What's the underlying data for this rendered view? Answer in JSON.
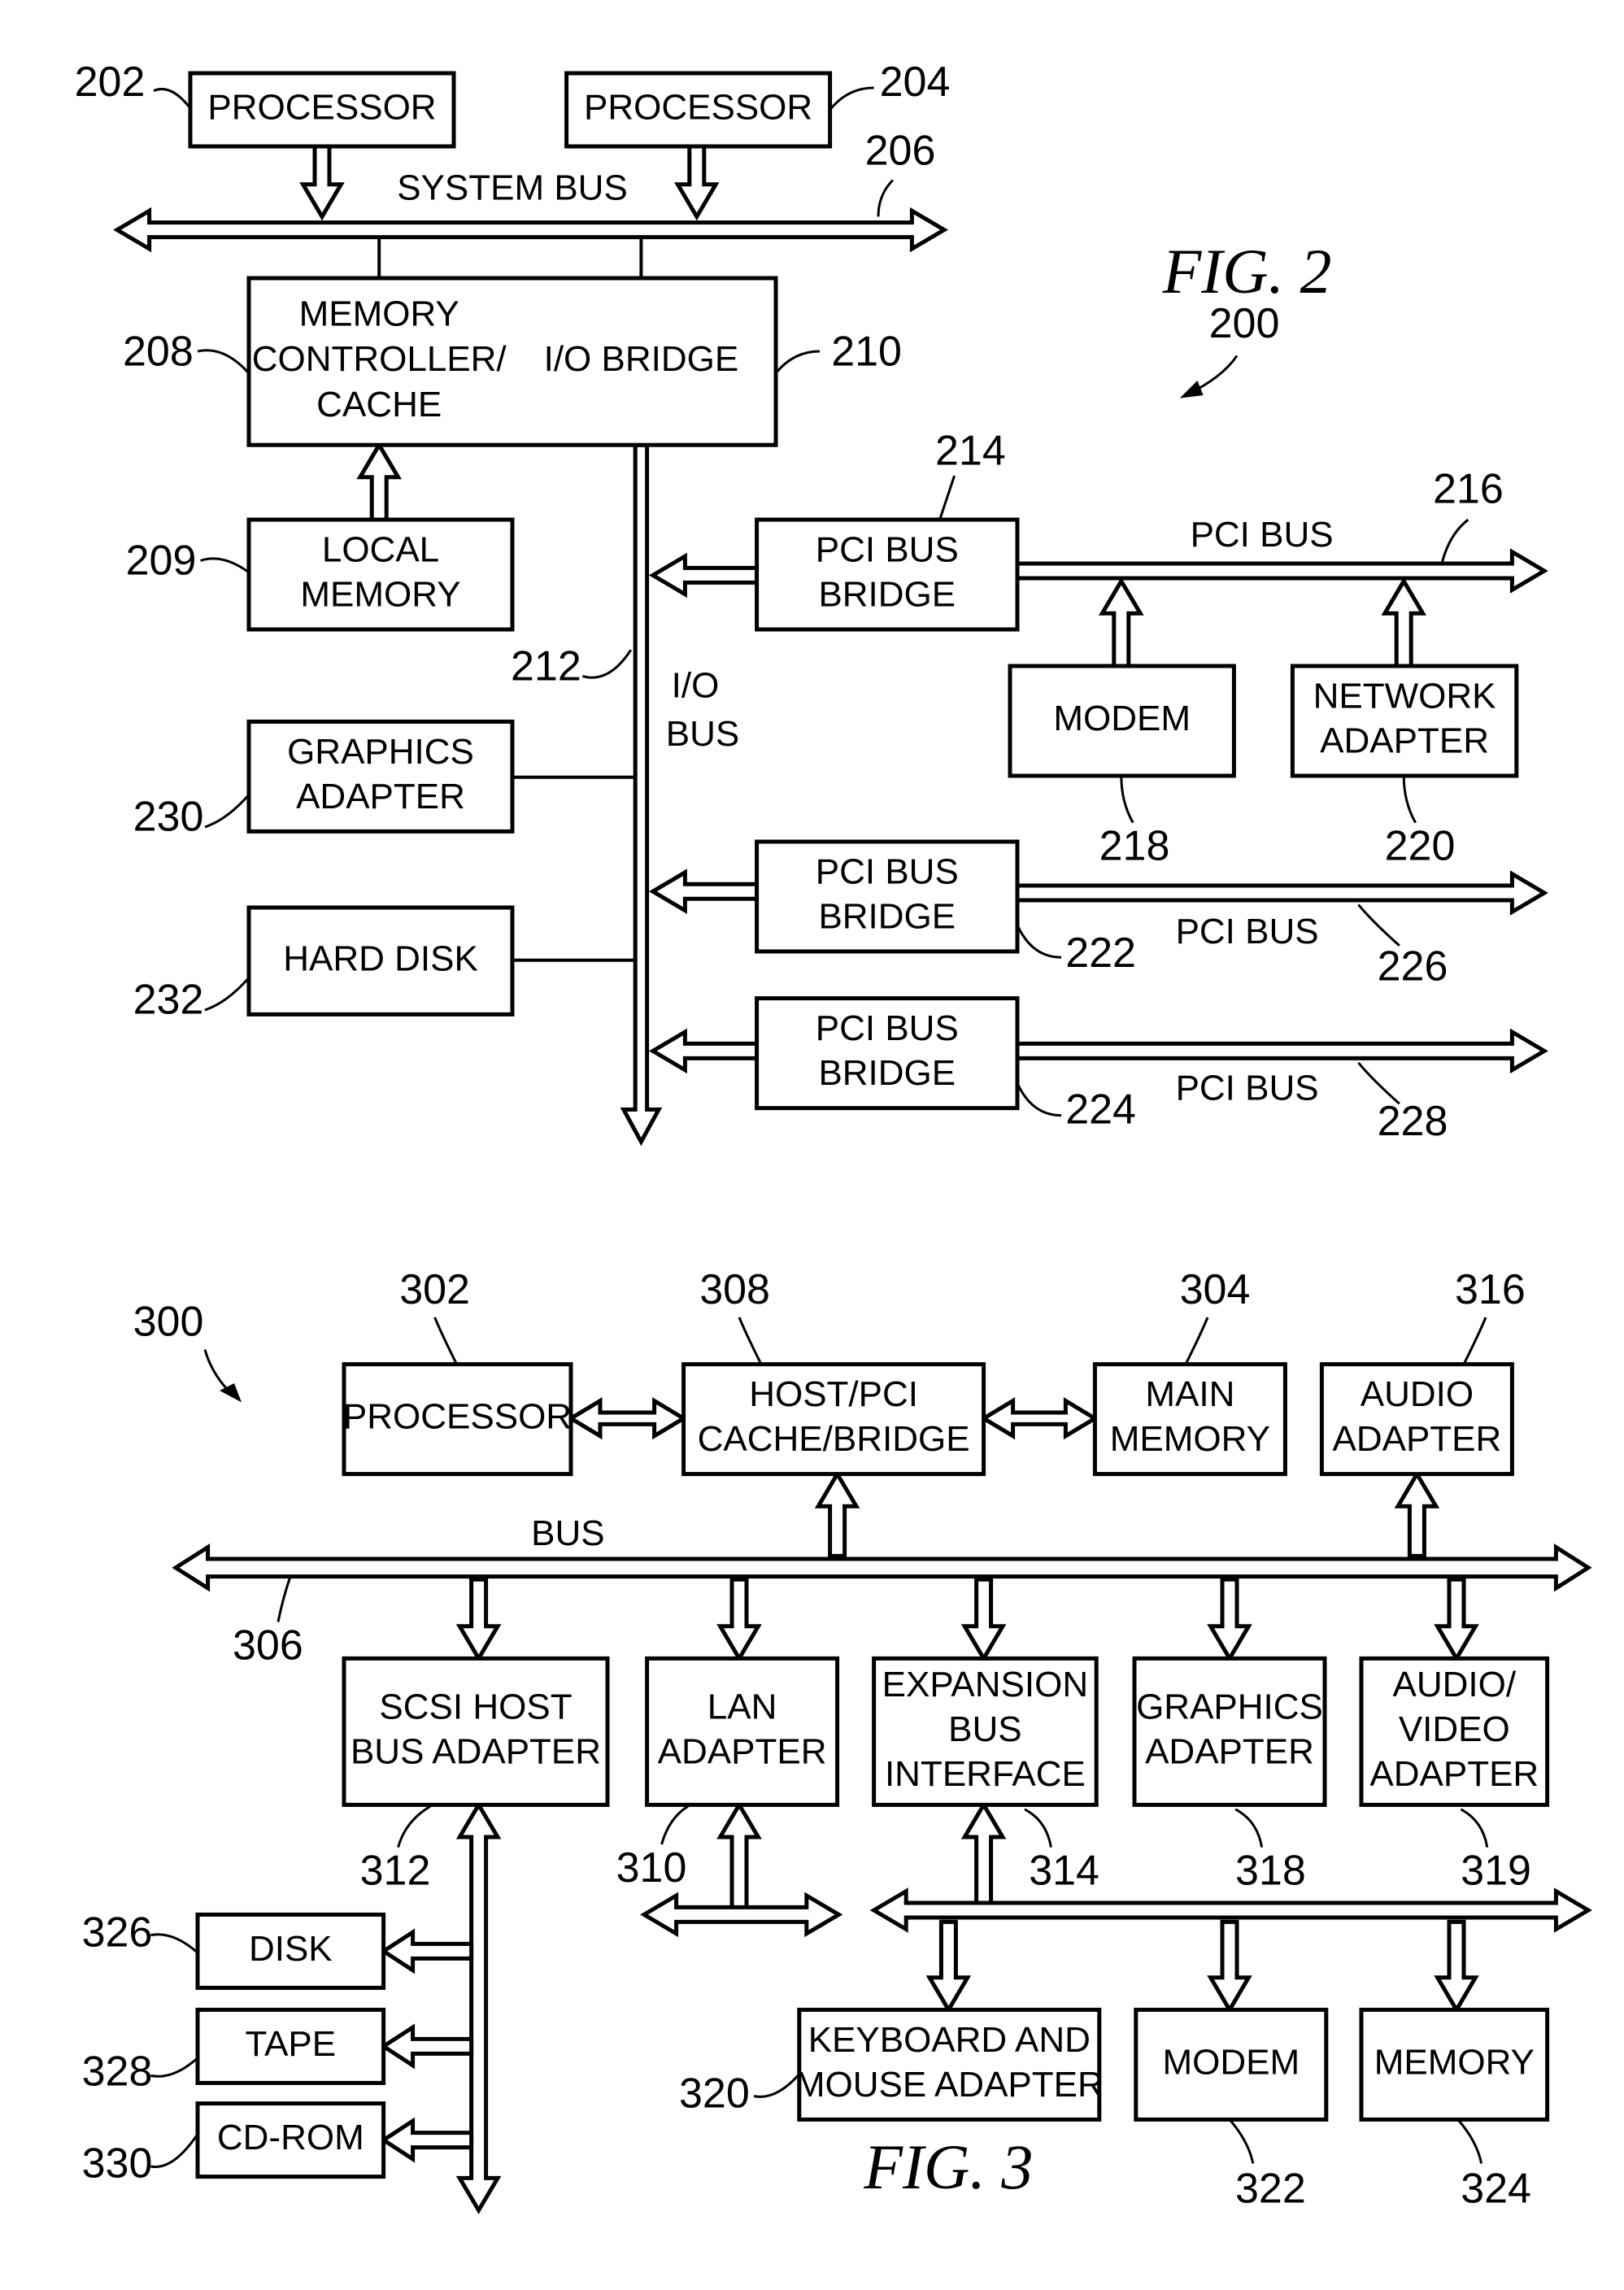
{
  "fig2": {
    "title": "FIG. 2",
    "ref": "200",
    "system_bus_label": "SYSTEM BUS",
    "io_bus_label": [
      "I/O",
      "BUS"
    ],
    "pci_bus_label": "PCI BUS",
    "boxes": {
      "proc1": {
        "lines": [
          "PROCESSOR"
        ],
        "ref": "202"
      },
      "proc2": {
        "lines": [
          "PROCESSOR"
        ],
        "ref": "204"
      },
      "memctrl": {
        "lines": [
          "MEMORY",
          "CONTROLLER/",
          "CACHE"
        ],
        "ref": "208"
      },
      "iobridge": {
        "lines": [
          "I/O BRIDGE"
        ],
        "ref": "210"
      },
      "localmem": {
        "lines": [
          "LOCAL",
          "MEMORY"
        ],
        "ref": "209"
      },
      "graphics": {
        "lines": [
          "GRAPHICS",
          "ADAPTER"
        ],
        "ref": "230"
      },
      "harddisk": {
        "lines": [
          "HARD DISK"
        ],
        "ref": "232"
      },
      "pci1": {
        "lines": [
          "PCI BUS",
          "BRIDGE"
        ],
        "ref": "214"
      },
      "modem": {
        "lines": [
          "MODEM"
        ],
        "ref": "218"
      },
      "netadapter": {
        "lines": [
          "NETWORK",
          "ADAPTER"
        ],
        "ref": "220"
      },
      "pci2": {
        "lines": [
          "PCI BUS",
          "BRIDGE"
        ],
        "ref": "222"
      },
      "pci3": {
        "lines": [
          "PCI BUS",
          "BRIDGE"
        ],
        "ref": "224"
      }
    },
    "refs": {
      "system_bus": "206",
      "io_bus": "212",
      "pci_bus1": "216",
      "pci_bus2": "226",
      "pci_bus3": "228"
    }
  },
  "fig3": {
    "title": "FIG. 3",
    "ref": "300",
    "bus_label": "BUS",
    "boxes": {
      "processor": {
        "lines": [
          "PROCESSOR"
        ],
        "ref": "302"
      },
      "hostpci": {
        "lines": [
          "HOST/PCI",
          "CACHE/BRIDGE"
        ],
        "ref": "308"
      },
      "mainmem": {
        "lines": [
          "MAIN",
          "MEMORY"
        ],
        "ref": "304"
      },
      "audio": {
        "lines": [
          "AUDIO",
          "ADAPTER"
        ],
        "ref": "316"
      },
      "scsi": {
        "lines": [
          "SCSI HOST",
          "BUS ADAPTER"
        ],
        "ref": "312"
      },
      "lan": {
        "lines": [
          "LAN",
          "ADAPTER"
        ],
        "ref": "310"
      },
      "expansion": {
        "lines": [
          "EXPANSION",
          "BUS",
          "INTERFACE"
        ],
        "ref": "314"
      },
      "graphics": {
        "lines": [
          "GRAPHICS",
          "ADAPTER"
        ],
        "ref": "318"
      },
      "av": {
        "lines": [
          "AUDIO/",
          "VIDEO",
          "ADAPTER"
        ],
        "ref": "319"
      },
      "disk": {
        "lines": [
          "DISK"
        ],
        "ref": "326"
      },
      "tape": {
        "lines": [
          "TAPE"
        ],
        "ref": "328"
      },
      "cdrom": {
        "lines": [
          "CD-ROM"
        ],
        "ref": "330"
      },
      "kbd": {
        "lines": [
          "KEYBOARD AND",
          "MOUSE ADAPTER"
        ],
        "ref": "320"
      },
      "modem": {
        "lines": [
          "MODEM"
        ],
        "ref": "322"
      },
      "memory": {
        "lines": [
          "MEMORY"
        ],
        "ref": "324"
      }
    },
    "refs": {
      "bus": "306"
    }
  }
}
